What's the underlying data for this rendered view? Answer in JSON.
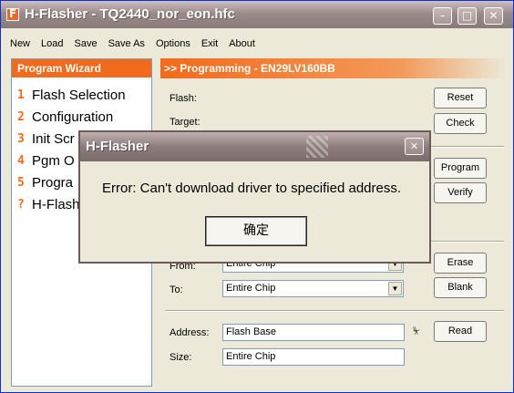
{
  "window": {
    "title": "H-Flasher - TQ2440_nor_eon.hfc"
  },
  "menu": [
    "New",
    "Load",
    "Save",
    "Save As",
    "Options",
    "Exit",
    "About"
  ],
  "wizard": {
    "title": "Program Wizard",
    "items": [
      {
        "num": "1",
        "label": "Flash Selection"
      },
      {
        "num": "2",
        "label": "Configuration"
      },
      {
        "num": "3",
        "label": "Init Scr"
      },
      {
        "num": "4",
        "label": "Pgm O"
      },
      {
        "num": "5",
        "label": "Progra"
      },
      {
        "num": "?",
        "label": "H-Flash"
      }
    ]
  },
  "programming": {
    "title": ">> Programming - EN29LV160BB",
    "flash_label": "Flash:",
    "target_label": "Target:",
    "from_label": "From:",
    "from_value": "Entire Chip",
    "to_label": "To:",
    "to_value": "Entire Chip",
    "address_label": "Address:",
    "address_value": "Flash Base",
    "size_label": "Size:",
    "size_value": "Entire Chip",
    "buttons": {
      "reset": "Reset",
      "check": "Check",
      "program": "Program",
      "verify": "Verify",
      "erase": "Erase",
      "blank": "Blank",
      "read": "Read"
    }
  },
  "dialog": {
    "title": "H-Flasher",
    "message": "Error: Can't download driver to specified address.",
    "ok_label": "确定"
  }
}
